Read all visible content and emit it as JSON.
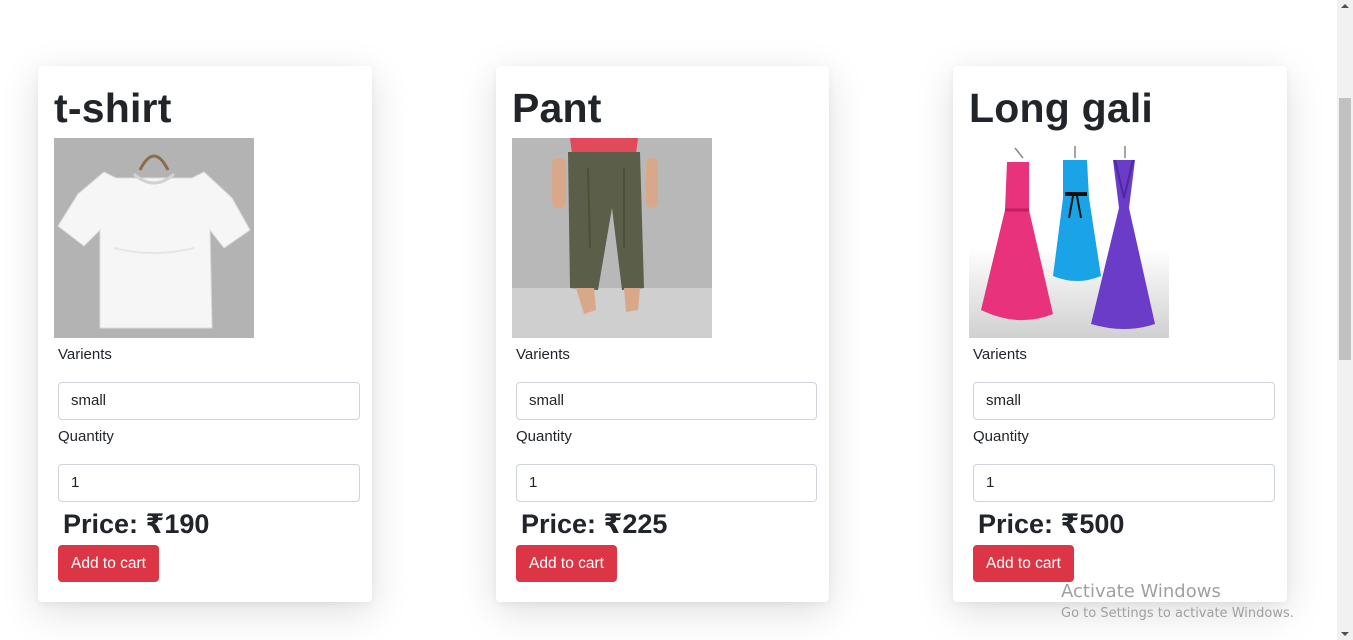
{
  "products": [
    {
      "title": "t-shirt",
      "image_alt": "t-shirt",
      "variants_label": "Varients",
      "variant_value": "small",
      "quantity_label": "Quantity",
      "quantity_value": "1",
      "price": "Price: ₹190",
      "button_label": "Add to cart"
    },
    {
      "title": "Pant",
      "image_alt": "Pant",
      "variants_label": "Varients",
      "variant_value": "small",
      "quantity_label": "Quantity",
      "quantity_value": "1",
      "price": "Price: ₹225",
      "button_label": "Add to cart"
    },
    {
      "title": "Long gali",
      "image_alt": "Long gali",
      "variants_label": "Varients",
      "variant_value": "small",
      "quantity_label": "Quantity",
      "quantity_value": "1",
      "price": "Price: ₹500",
      "button_label": "Add to cart"
    }
  ],
  "watermark": {
    "title": "Activate Windows",
    "subtitle": "Go to Settings to activate Windows."
  },
  "colors": {
    "button": "#dc3545",
    "text": "#212529",
    "input_border": "#ced4da"
  }
}
